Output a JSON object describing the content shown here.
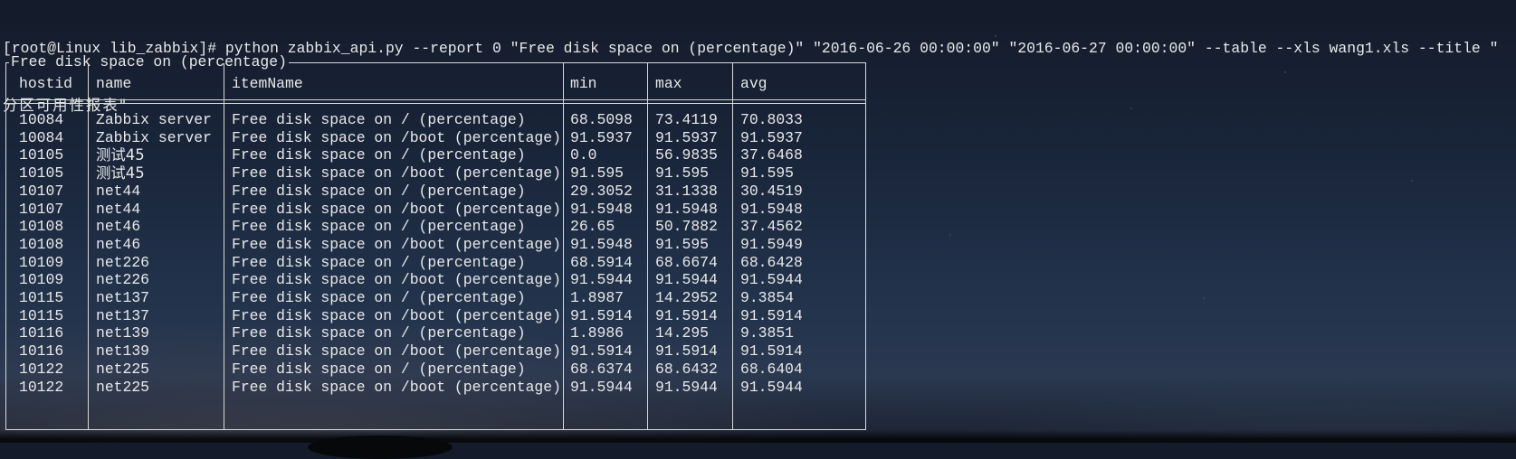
{
  "terminal": {
    "command_line_1": "[root@Linux lib_zabbix]# python zabbix_api.py --report 0 \"Free disk space on (percentage)\" \"2016-06-26 00:00:00\" \"2016-06-27 00:00:00\" --table --xls wang1.xls --title \"",
    "command_line_2": "分区可用性报表\""
  },
  "report": {
    "title": "Free disk space on (percentage)",
    "columns": [
      "hostid",
      "name",
      "itemName",
      "min",
      "max",
      "avg"
    ],
    "rows": [
      [
        "10084",
        "Zabbix server",
        "Free disk space on / (percentage)",
        "68.5098",
        "73.4119",
        "70.8033"
      ],
      [
        "10084",
        "Zabbix server",
        "Free disk space on /boot (percentage)",
        "91.5937",
        "91.5937",
        "91.5937"
      ],
      [
        "10105",
        "测试45",
        "Free disk space on / (percentage)",
        "0.0",
        "56.9835",
        "37.6468"
      ],
      [
        "10105",
        "测试45",
        "Free disk space on /boot (percentage)",
        "91.595",
        "91.595",
        "91.595"
      ],
      [
        "10107",
        "net44",
        "Free disk space on / (percentage)",
        "29.3052",
        "31.1338",
        "30.4519"
      ],
      [
        "10107",
        "net44",
        "Free disk space on /boot (percentage)",
        "91.5948",
        "91.5948",
        "91.5948"
      ],
      [
        "10108",
        "net46",
        "Free disk space on / (percentage)",
        "26.65",
        "50.7882",
        "37.4562"
      ],
      [
        "10108",
        "net46",
        "Free disk space on /boot (percentage)",
        "91.5948",
        "91.595",
        "91.5949"
      ],
      [
        "10109",
        "net226",
        "Free disk space on / (percentage)",
        "68.5914",
        "68.6674",
        "68.6428"
      ],
      [
        "10109",
        "net226",
        "Free disk space on /boot (percentage)",
        "91.5944",
        "91.5944",
        "91.5944"
      ],
      [
        "10115",
        "net137",
        "Free disk space on / (percentage)",
        "1.8987",
        "14.2952",
        "9.3854"
      ],
      [
        "10115",
        "net137",
        "Free disk space on /boot (percentage)",
        "91.5914",
        "91.5914",
        "91.5914"
      ],
      [
        "10116",
        "net139",
        "Free disk space on / (percentage)",
        "1.8986",
        "14.295",
        "9.3851"
      ],
      [
        "10116",
        "net139",
        "Free disk space on /boot (percentage)",
        "91.5914",
        "91.5914",
        "91.5914"
      ],
      [
        "10122",
        "net225",
        "Free disk space on / (percentage)",
        "68.6374",
        "68.6432",
        "68.6404"
      ],
      [
        "10122",
        "net225",
        "Free disk space on /boot (percentage)",
        "91.5944",
        "91.5944",
        "91.5944"
      ]
    ]
  },
  "colors": {
    "text": "#e9e9e9",
    "border": "#d8d8d8",
    "background": "#19253a"
  }
}
